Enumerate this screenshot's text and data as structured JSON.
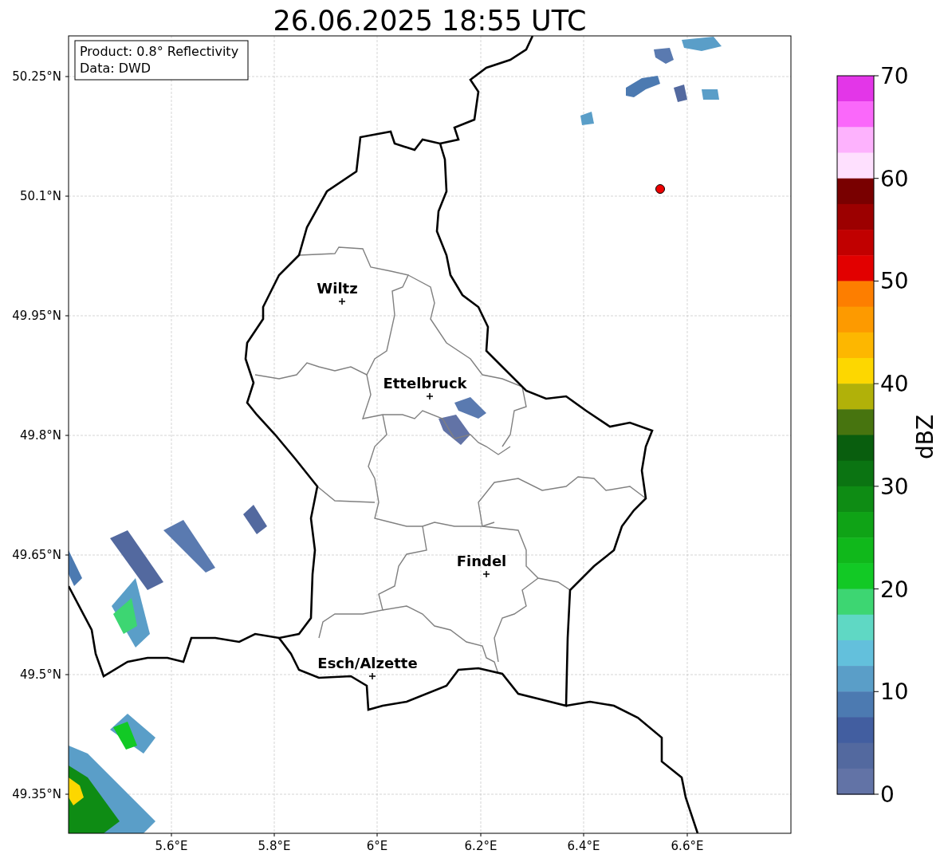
{
  "title": "26.06.2025 18:55 UTC",
  "info_box": [
    "Product: 0.8° Reflectivity",
    "Data: DWD"
  ],
  "lat_ticks": [
    "50.25°N",
    "50.1°N",
    "49.95°N",
    "49.8°N",
    "49.65°N",
    "49.5°N",
    "49.35°N"
  ],
  "lon_ticks": [
    "5.6°E",
    "5.8°E",
    "6°E",
    "6.2°E",
    "6.4°E",
    "6.6°E"
  ],
  "cities": [
    {
      "name": "Wiltz"
    },
    {
      "name": "Ettelbruck"
    },
    {
      "name": "Findel"
    },
    {
      "name": "Esch/Alzette"
    }
  ],
  "colorbar": {
    "label": "dBZ",
    "ticks": [
      "70",
      "60",
      "50",
      "40",
      "30",
      "20",
      "10",
      "0"
    ],
    "bins": [
      {
        "color": "#e336e8"
      },
      {
        "color": "#fa68fa"
      },
      {
        "color": "#fdb2fd"
      },
      {
        "color": "#fee0fe"
      },
      {
        "color": "#790000"
      },
      {
        "color": "#9c0000"
      },
      {
        "color": "#c10000"
      },
      {
        "color": "#e20000"
      },
      {
        "color": "#fd7e00"
      },
      {
        "color": "#fd9a00"
      },
      {
        "color": "#fdb700"
      },
      {
        "color": "#fdd700"
      },
      {
        "color": "#b1b109"
      },
      {
        "color": "#47740f"
      },
      {
        "color": "#095e0e"
      },
      {
        "color": "#0b7412"
      },
      {
        "color": "#0e8c14"
      },
      {
        "color": "#0fa316"
      },
      {
        "color": "#10b81b"
      },
      {
        "color": "#12c925"
      },
      {
        "color": "#3dd672"
      },
      {
        "color": "#5fd8c4"
      },
      {
        "color": "#63c0dc"
      },
      {
        "color": "#5a9ec8"
      },
      {
        "color": "#4c7ab1"
      },
      {
        "color": "#425ea0"
      },
      {
        "color": "#53699f"
      },
      {
        "color": "#6273a6"
      }
    ]
  }
}
